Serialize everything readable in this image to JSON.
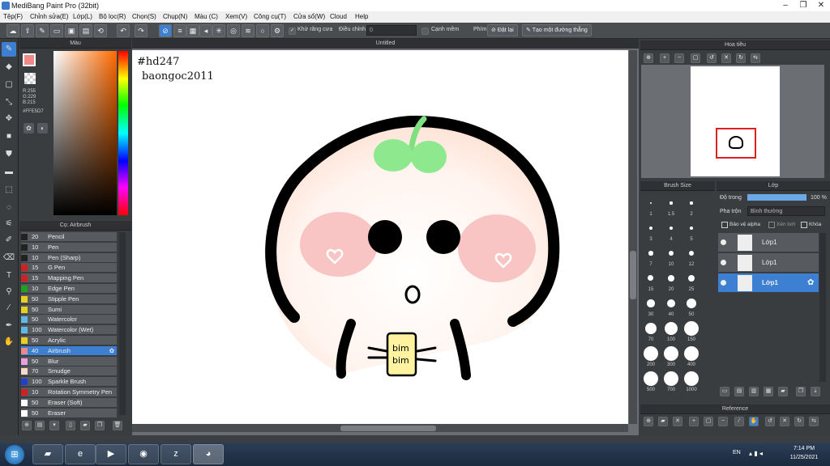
{
  "app": {
    "title": "MediBang Paint Pro (32bit)"
  },
  "menu": [
    "Tệp(F)",
    "Chỉnh sửa(E)",
    "Lớp(L)",
    "Bộ lọc(R)",
    "Chọn(S)",
    "Chụp(N)",
    "Màu (C)",
    "Xem(V)",
    "Công cụ(T)",
    "Cửa sổ(W)",
    "Cloud",
    "Help"
  ],
  "toolbar": {
    "antialias_label": "Khử răng cưa",
    "adjust_label": "Điều chỉnh",
    "adjust_value": "0",
    "soft_edge_label": "Cạnh mềm",
    "key_label": "Phím",
    "reset_label": "Đặt lại",
    "straight_line_label": "Tạo một đường thẳng"
  },
  "color_panel": {
    "title": "Màu",
    "rgb": [
      "R:255",
      "G:229",
      "B:215"
    ],
    "hex": "#FFE5D7",
    "fg": "#f08a8a"
  },
  "brush_panel": {
    "title": "Cọ: Airbrush",
    "brushes": [
      {
        "size": "20",
        "name": "Pencil",
        "color": "#222222"
      },
      {
        "size": "10",
        "name": "Pen",
        "color": "#222222"
      },
      {
        "size": "10",
        "name": "Pen (Sharp)",
        "color": "#222222"
      },
      {
        "size": "15",
        "name": "G Pen",
        "color": "#d02020"
      },
      {
        "size": "15",
        "name": "Mapping Pen",
        "color": "#d02020"
      },
      {
        "size": "10",
        "name": "Edge Pen",
        "color": "#20a020"
      },
      {
        "size": "50",
        "name": "Stipple Pen",
        "color": "#e8d020"
      },
      {
        "size": "50",
        "name": "Sumi",
        "color": "#e8d020"
      },
      {
        "size": "50",
        "name": "Watercolor",
        "color": "#60b8e8"
      },
      {
        "size": "100",
        "name": "Watercolor (Wet)",
        "color": "#60b8e8"
      },
      {
        "size": "50",
        "name": "Acrylic",
        "color": "#e8d020"
      },
      {
        "size": "40",
        "name": "Airbrush",
        "color": "#e88a8a",
        "selected": true
      },
      {
        "size": "50",
        "name": "Blur",
        "color": "#e8a0e0"
      },
      {
        "size": "70",
        "name": "Smudge",
        "color": "#f8d8c8"
      },
      {
        "size": "100",
        "name": "Sparkle Brush",
        "color": "#2040d0"
      },
      {
        "size": "10",
        "name": "Rotation Symmetry Pen",
        "color": "#d02020"
      },
      {
        "size": "50",
        "name": "Eraser (Soft)",
        "color": "#ffffff"
      },
      {
        "size": "50",
        "name": "Eraser",
        "color": "#ffffff"
      }
    ]
  },
  "document": {
    "tab": "Untitled",
    "text_line1": "#hd247",
    "text_line2": "baongoc2011",
    "tag_text_1": "bim",
    "tag_text_2": "bim"
  },
  "navigator": {
    "title": "Hoa tiêu"
  },
  "brush_size": {
    "title": "Brush Size",
    "sizes": [
      "1",
      "1.5",
      "2",
      "3",
      "4",
      "5",
      "7",
      "10",
      "12",
      "15",
      "20",
      "25",
      "30",
      "40",
      "50",
      "70",
      "100",
      "150",
      "200",
      "300",
      "400",
      "500",
      "700",
      "1000"
    ]
  },
  "layer_panel": {
    "title": "Lớp",
    "opacity_label": "Độ trong",
    "opacity_value": "100 %",
    "opacity": 1.0,
    "blend_label": "Pha trộn",
    "blend_value": "Bình thường",
    "protect_alpha": "Bảo vệ alpha",
    "clipping": "Xén bớt",
    "lock": "Khóa",
    "layers": [
      "Lớp1",
      "Lớp1",
      "Lớp1"
    ]
  },
  "reference": {
    "title": "Reference"
  },
  "taskbar": {
    "lang": "EN",
    "time": "7:14 PM",
    "date": "11/25/2021"
  }
}
